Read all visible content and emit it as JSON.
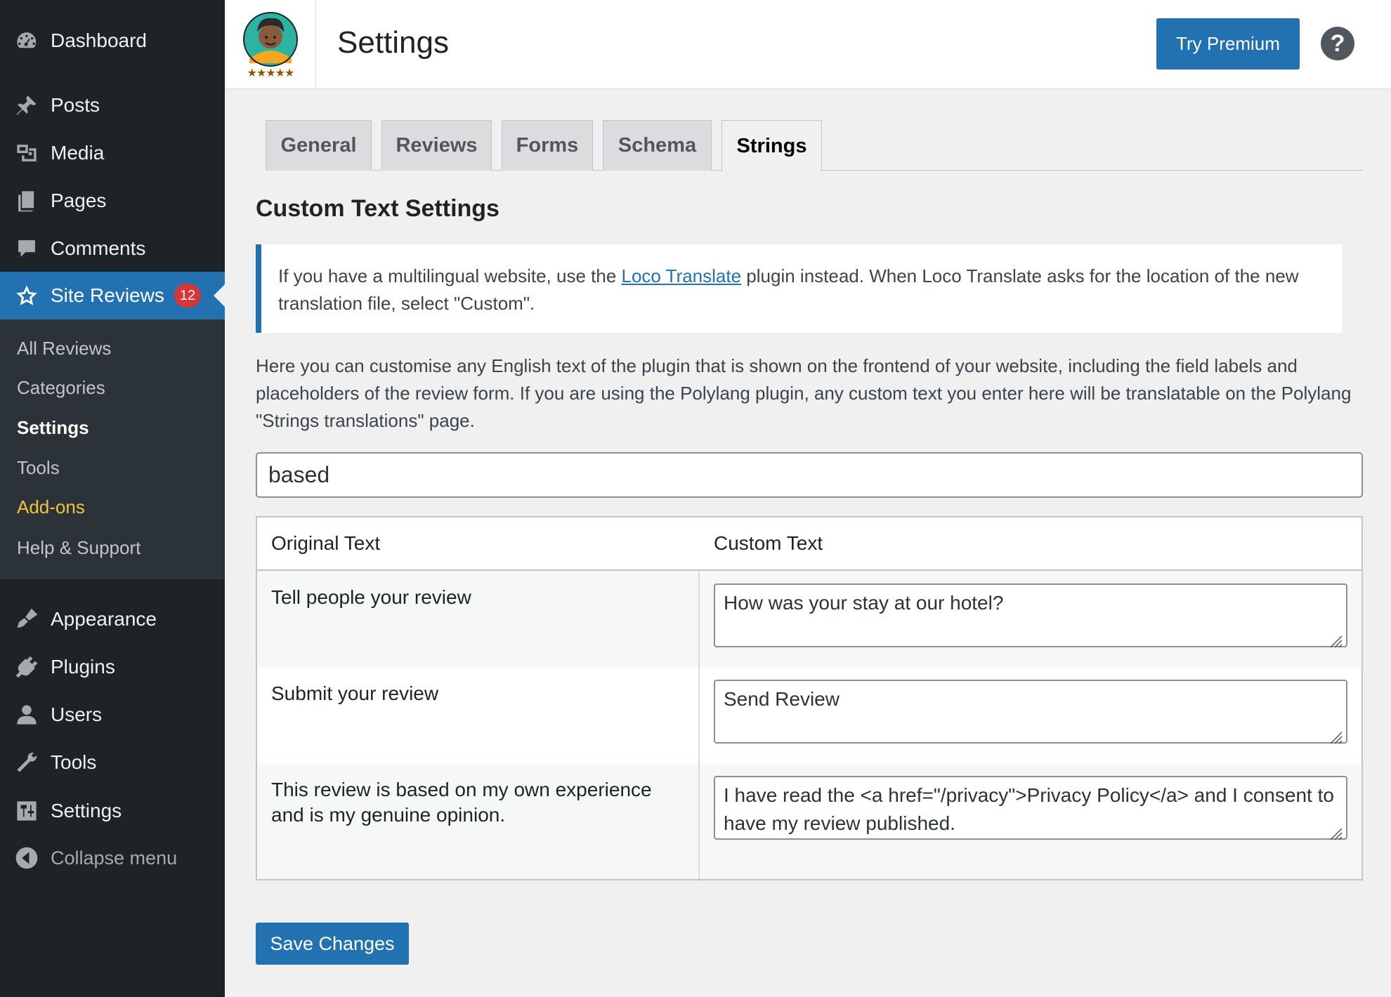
{
  "sidebar": {
    "menu": {
      "dashboard": "Dashboard",
      "posts": "Posts",
      "media": "Media",
      "pages": "Pages",
      "comments": "Comments",
      "site_reviews": "Site Reviews",
      "site_reviews_badge": "12",
      "appearance": "Appearance",
      "plugins": "Plugins",
      "users": "Users",
      "tools": "Tools",
      "settings": "Settings",
      "collapse": "Collapse menu"
    },
    "submenu": {
      "all_reviews": "All Reviews",
      "categories": "Categories",
      "settings": "Settings",
      "tools": "Tools",
      "addons": "Add-ons",
      "help": "Help & Support"
    },
    "colors": {
      "background": "#1d2327",
      "active": "#2271b1",
      "addons": "#f0c33c"
    }
  },
  "header": {
    "title": "Settings",
    "premium_button": "Try Premium",
    "help_symbol": "?",
    "logo_stars": "★★★★★"
  },
  "tabs": [
    {
      "label": "General",
      "active": false
    },
    {
      "label": "Reviews",
      "active": false
    },
    {
      "label": "Forms",
      "active": false
    },
    {
      "label": "Schema",
      "active": false
    },
    {
      "label": "Strings",
      "active": true
    }
  ],
  "content": {
    "section_title": "Custom Text Settings",
    "notice": {
      "before_link": "If you have a multilingual website, use the ",
      "link": "Loco Translate",
      "after_link": " plugin instead. When Loco Translate asks for the location of the new translation file, select \"Custom\"."
    },
    "intro": "Here you can customise any English text of the plugin that is shown on the frontend of your website, including the field labels and placeholders of the review form. If you are using the Polylang plugin, any custom text you enter here will be translatable on the Polylang \"Strings translations\" page.",
    "search_value": "based",
    "table": {
      "col_original": "Original Text",
      "col_custom": "Custom Text",
      "rows": [
        {
          "original": "Tell people your review",
          "custom": "How was your stay at our hotel?"
        },
        {
          "original": "Submit your review",
          "custom": "Send Review"
        },
        {
          "original": "This review is based on my own experience and is my genuine opinion.",
          "custom": "I have read the <a href=\"/privacy\">Privacy Policy</a> and I consent to have my review published."
        }
      ]
    },
    "save_button": "Save Changes"
  }
}
